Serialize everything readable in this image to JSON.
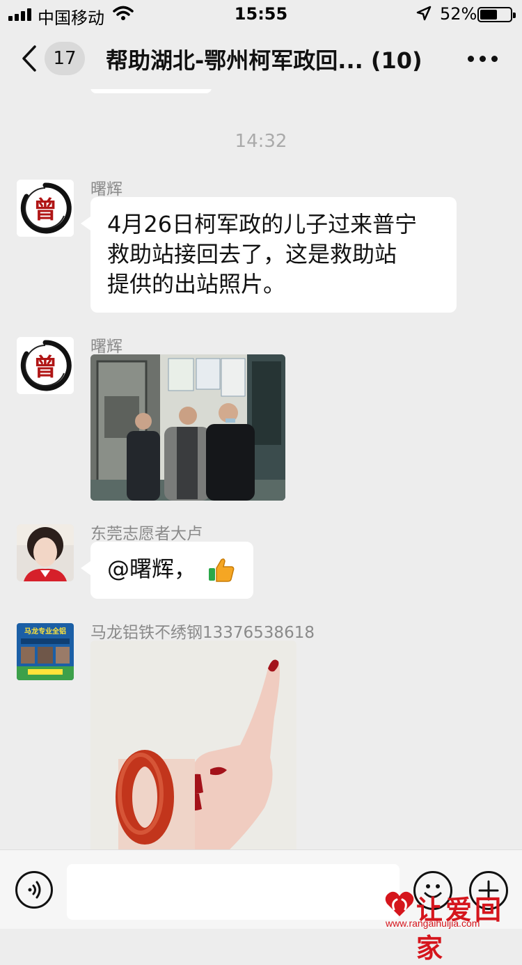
{
  "status_bar": {
    "carrier": "中国移动",
    "time": "15:55",
    "battery_percent": "52%",
    "icons": [
      "signal-icon",
      "wifi-icon",
      "location-icon",
      "battery-icon"
    ]
  },
  "nav": {
    "unread_count": "17",
    "title": "帮助湖北-鄂州柯军政回... (10)",
    "icons": [
      "back-icon",
      "more-icon"
    ]
  },
  "chat": {
    "timestamp": "14:32",
    "messages": [
      {
        "sender": "曙辉",
        "avatar_text": "曾",
        "type": "text",
        "lines": [
          "4月26日柯军政的儿子过来普宁",
          "救助站接回去了，这是救助站",
          "提供的出站照片。"
        ]
      },
      {
        "sender": "曙辉",
        "avatar_text": "曾",
        "type": "image"
      },
      {
        "sender": "东莞志愿者大卢",
        "type": "text",
        "text": "@曙辉，",
        "emoji": "thumbs-up-icon"
      },
      {
        "sender": "马龙铝铁不绣钢13376538618",
        "avatar_text": "马龙专业全铝",
        "type": "image"
      }
    ]
  },
  "input_bar": {
    "placeholder": "",
    "icons": [
      "voice-icon",
      "emoji-icon",
      "plus-icon"
    ]
  },
  "watermark": {
    "title": "让爱回家",
    "url": "www.rangaihuijia.com"
  },
  "colors": {
    "background": "#ededed",
    "bubble": "#ffffff",
    "watermark": "#d5151c"
  }
}
